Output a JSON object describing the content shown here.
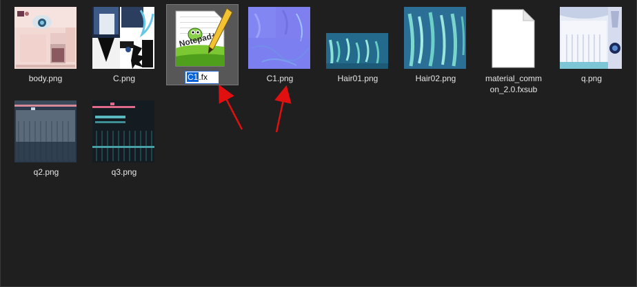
{
  "files": [
    {
      "name": "body.png"
    },
    {
      "name": "C.png"
    },
    {
      "name": "C1.fx",
      "name_selected_part": "C1",
      "name_rest": ".fx",
      "selected": true,
      "renaming": true,
      "thumbnail_logo_text": "Notepad++"
    },
    {
      "name": "C1.png"
    },
    {
      "name": "Hair01.png"
    },
    {
      "name": "Hair02.png"
    },
    {
      "name": "material_common_2.0.fxsub",
      "name_line1": "material_comm",
      "name_line2": "on_2.0.fxsub"
    },
    {
      "name": "q.png"
    },
    {
      "name": "q2.png"
    },
    {
      "name": "q3.png"
    }
  ],
  "colors": {
    "background": "#1f1f1f",
    "selection": "#575757",
    "text": "#e6e6e6",
    "arrow": "#e01010",
    "rename_highlight": "#0a64d6"
  },
  "icons": [
    "notepad-plus-plus-icon",
    "generic-file-icon",
    "red-arrow-annotation"
  ]
}
